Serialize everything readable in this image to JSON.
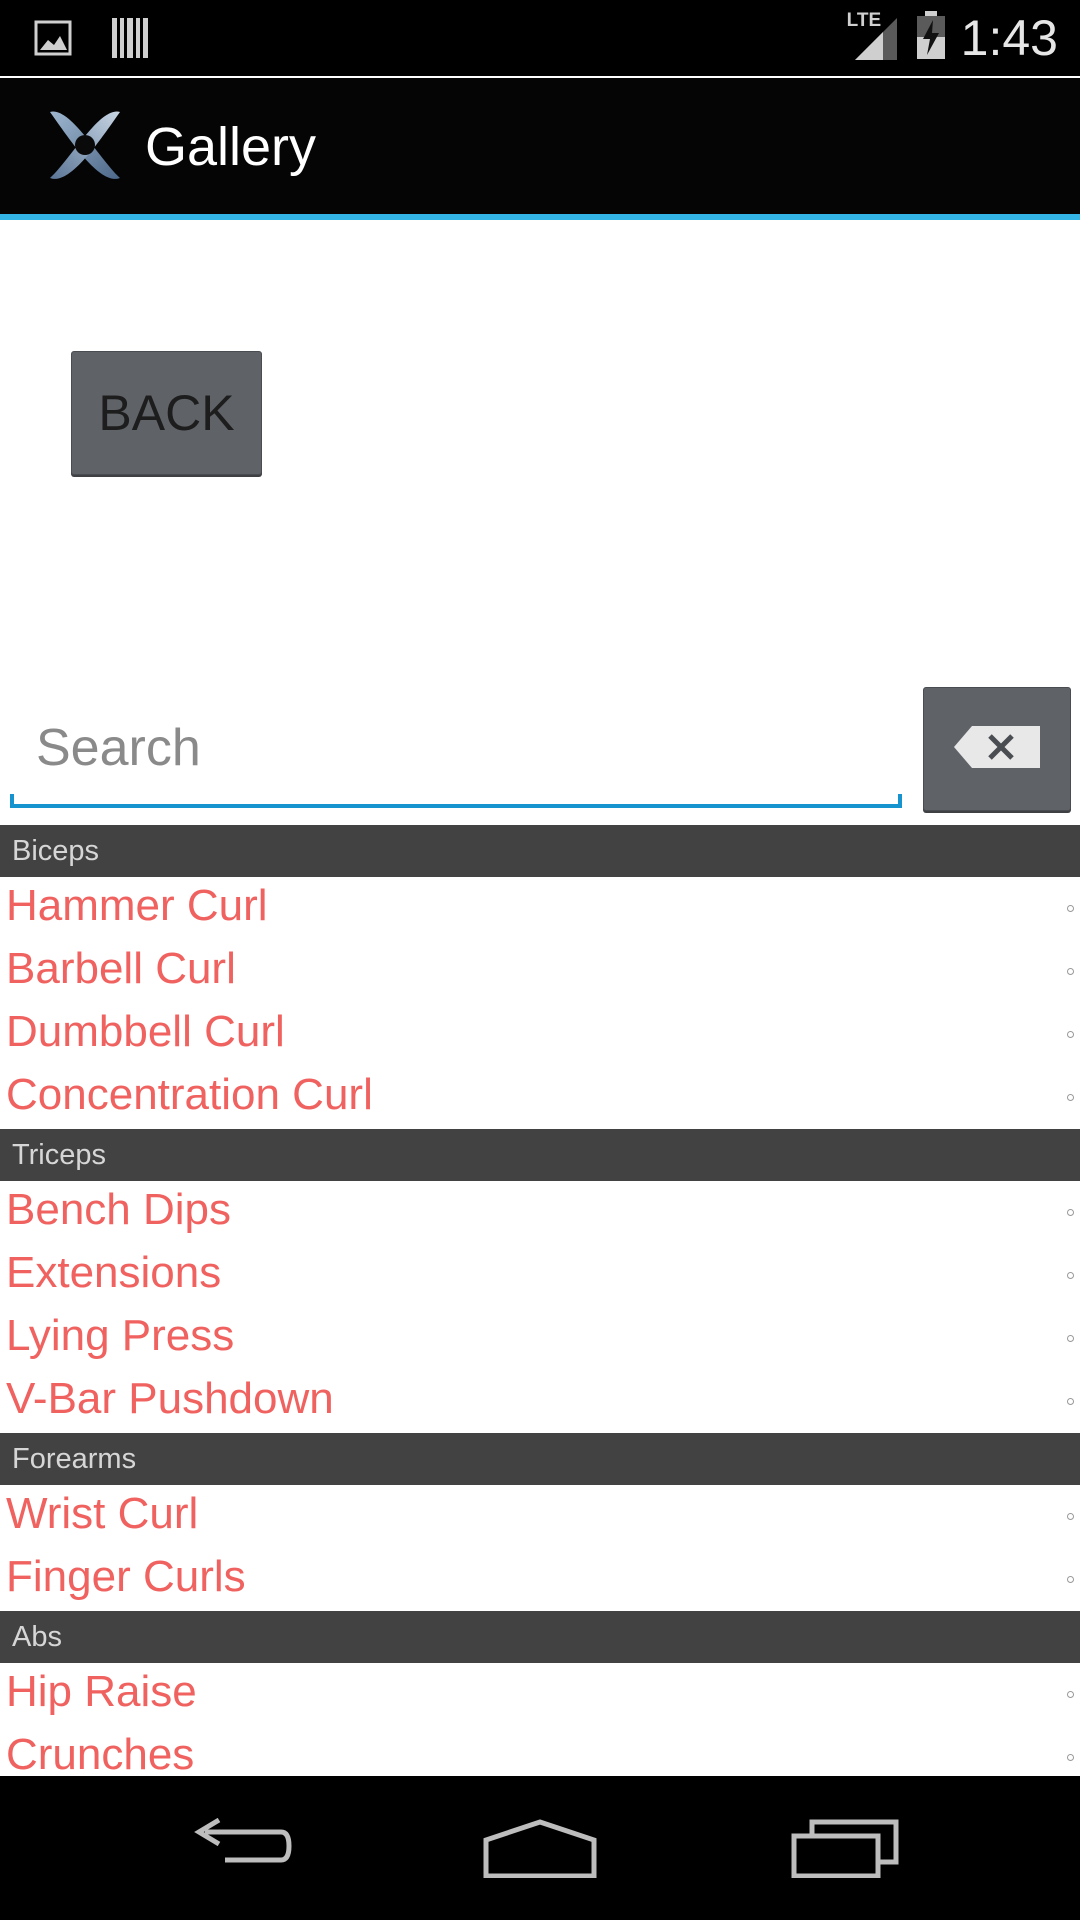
{
  "status_bar": {
    "time": "1:43",
    "network_label": "LTE",
    "icons": [
      "gallery-notification-icon",
      "barcode-notification-icon",
      "lte-signal-icon",
      "battery-charging-icon"
    ]
  },
  "action_bar": {
    "title": "Gallery",
    "logo_icon": "xamarin-logo-icon",
    "accent_color": "#33b5e5"
  },
  "main": {
    "back_label": "BACK",
    "search": {
      "value": "",
      "placeholder": "Search"
    },
    "clear_icon": "backspace-clear-icon"
  },
  "colors": {
    "item_text": "#f0625f",
    "section_bg": "#424242",
    "button_bg": "#5f6368"
  },
  "list": {
    "sections": [
      {
        "header": "Biceps",
        "items": [
          "Hammer Curl",
          "Barbell Curl",
          "Dumbbell Curl",
          "Concentration Curl"
        ]
      },
      {
        "header": "Triceps",
        "items": [
          "Bench Dips",
          "Extensions",
          "Lying Press",
          "V-Bar Pushdown"
        ]
      },
      {
        "header": "Forearms",
        "items": [
          "Wrist Curl",
          "Finger Curls"
        ]
      },
      {
        "header": "Abs",
        "items": [
          "Hip Raise",
          "Crunches"
        ]
      }
    ]
  },
  "nav_bar": {
    "icons": [
      "back-nav-icon",
      "home-nav-icon",
      "recents-nav-icon"
    ]
  }
}
